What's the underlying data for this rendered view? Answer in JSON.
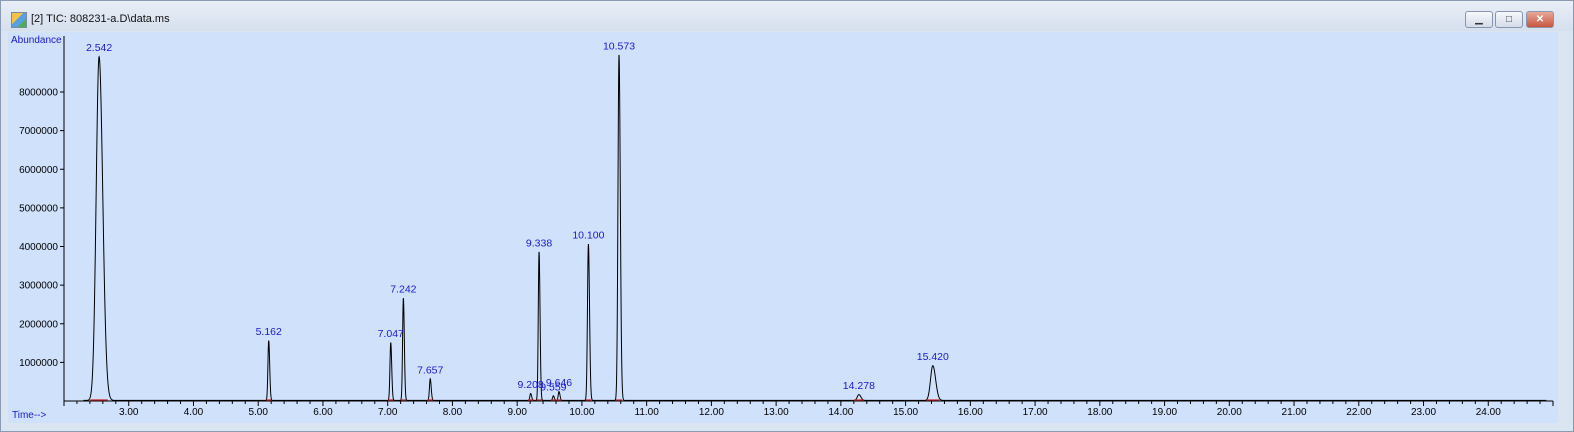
{
  "window": {
    "title": "[2] TIC: 808231-a.D\\data.ms",
    "min_glyph": "▁",
    "max_glyph": "□",
    "close_glyph": "✕"
  },
  "chart_data": {
    "type": "line",
    "ylabel": "Abundance",
    "xlabel": "Time-->",
    "xlim": [
      2.0,
      25.0
    ],
    "ylim": [
      0,
      9450000
    ],
    "x_ticks": [
      "3.00",
      "4.00",
      "5.00",
      "6.00",
      "7.00",
      "8.00",
      "9.00",
      "10.00",
      "11.00",
      "12.00",
      "13.00",
      "14.00",
      "15.00",
      "16.00",
      "17.00",
      "18.00",
      "19.00",
      "20.00",
      "21.00",
      "22.00",
      "23.00",
      "24.00"
    ],
    "y_ticks": [
      "1000000",
      "2000000",
      "3000000",
      "4000000",
      "5000000",
      "6000000",
      "7000000",
      "8000000"
    ],
    "series": [
      {
        "peaks": [
          {
            "label": "2.542",
            "rt": 2.542,
            "height": 8900000,
            "width": 0.045
          },
          {
            "label": "5.162",
            "rt": 5.162,
            "height": 1550000,
            "width": 0.012
          },
          {
            "label": "7.047",
            "rt": 7.047,
            "height": 1500000,
            "width": 0.012
          },
          {
            "label": "7.242",
            "rt": 7.242,
            "height": 2650000,
            "width": 0.012
          },
          {
            "label": "7.657",
            "rt": 7.657,
            "height": 560000,
            "width": 0.012
          },
          {
            "label": "9.208",
            "rt": 9.208,
            "height": 180000,
            "width": 0.012
          },
          {
            "label": "9.338",
            "rt": 9.338,
            "height": 3850000,
            "width": 0.012
          },
          {
            "label": "9.559",
            "rt": 9.559,
            "height": 120000,
            "width": 0.012
          },
          {
            "label": "9.646",
            "rt": 9.646,
            "height": 230000,
            "width": 0.012
          },
          {
            "label": "10.100",
            "rt": 10.1,
            "height": 4050000,
            "width": 0.014
          },
          {
            "label": "10.573",
            "rt": 10.573,
            "height": 8950000,
            "width": 0.016
          },
          {
            "label": "14.278",
            "rt": 14.278,
            "height": 150000,
            "width": 0.025
          },
          {
            "label": "15.420",
            "rt": 15.42,
            "height": 900000,
            "width": 0.035
          }
        ]
      }
    ],
    "colors": {
      "plot_bg": "#d0e1fb",
      "trace": "#000000",
      "peak_label": "#1a1ad0",
      "axis_text": "#1a1ad0",
      "baseline_marks": "#cc2222"
    }
  }
}
